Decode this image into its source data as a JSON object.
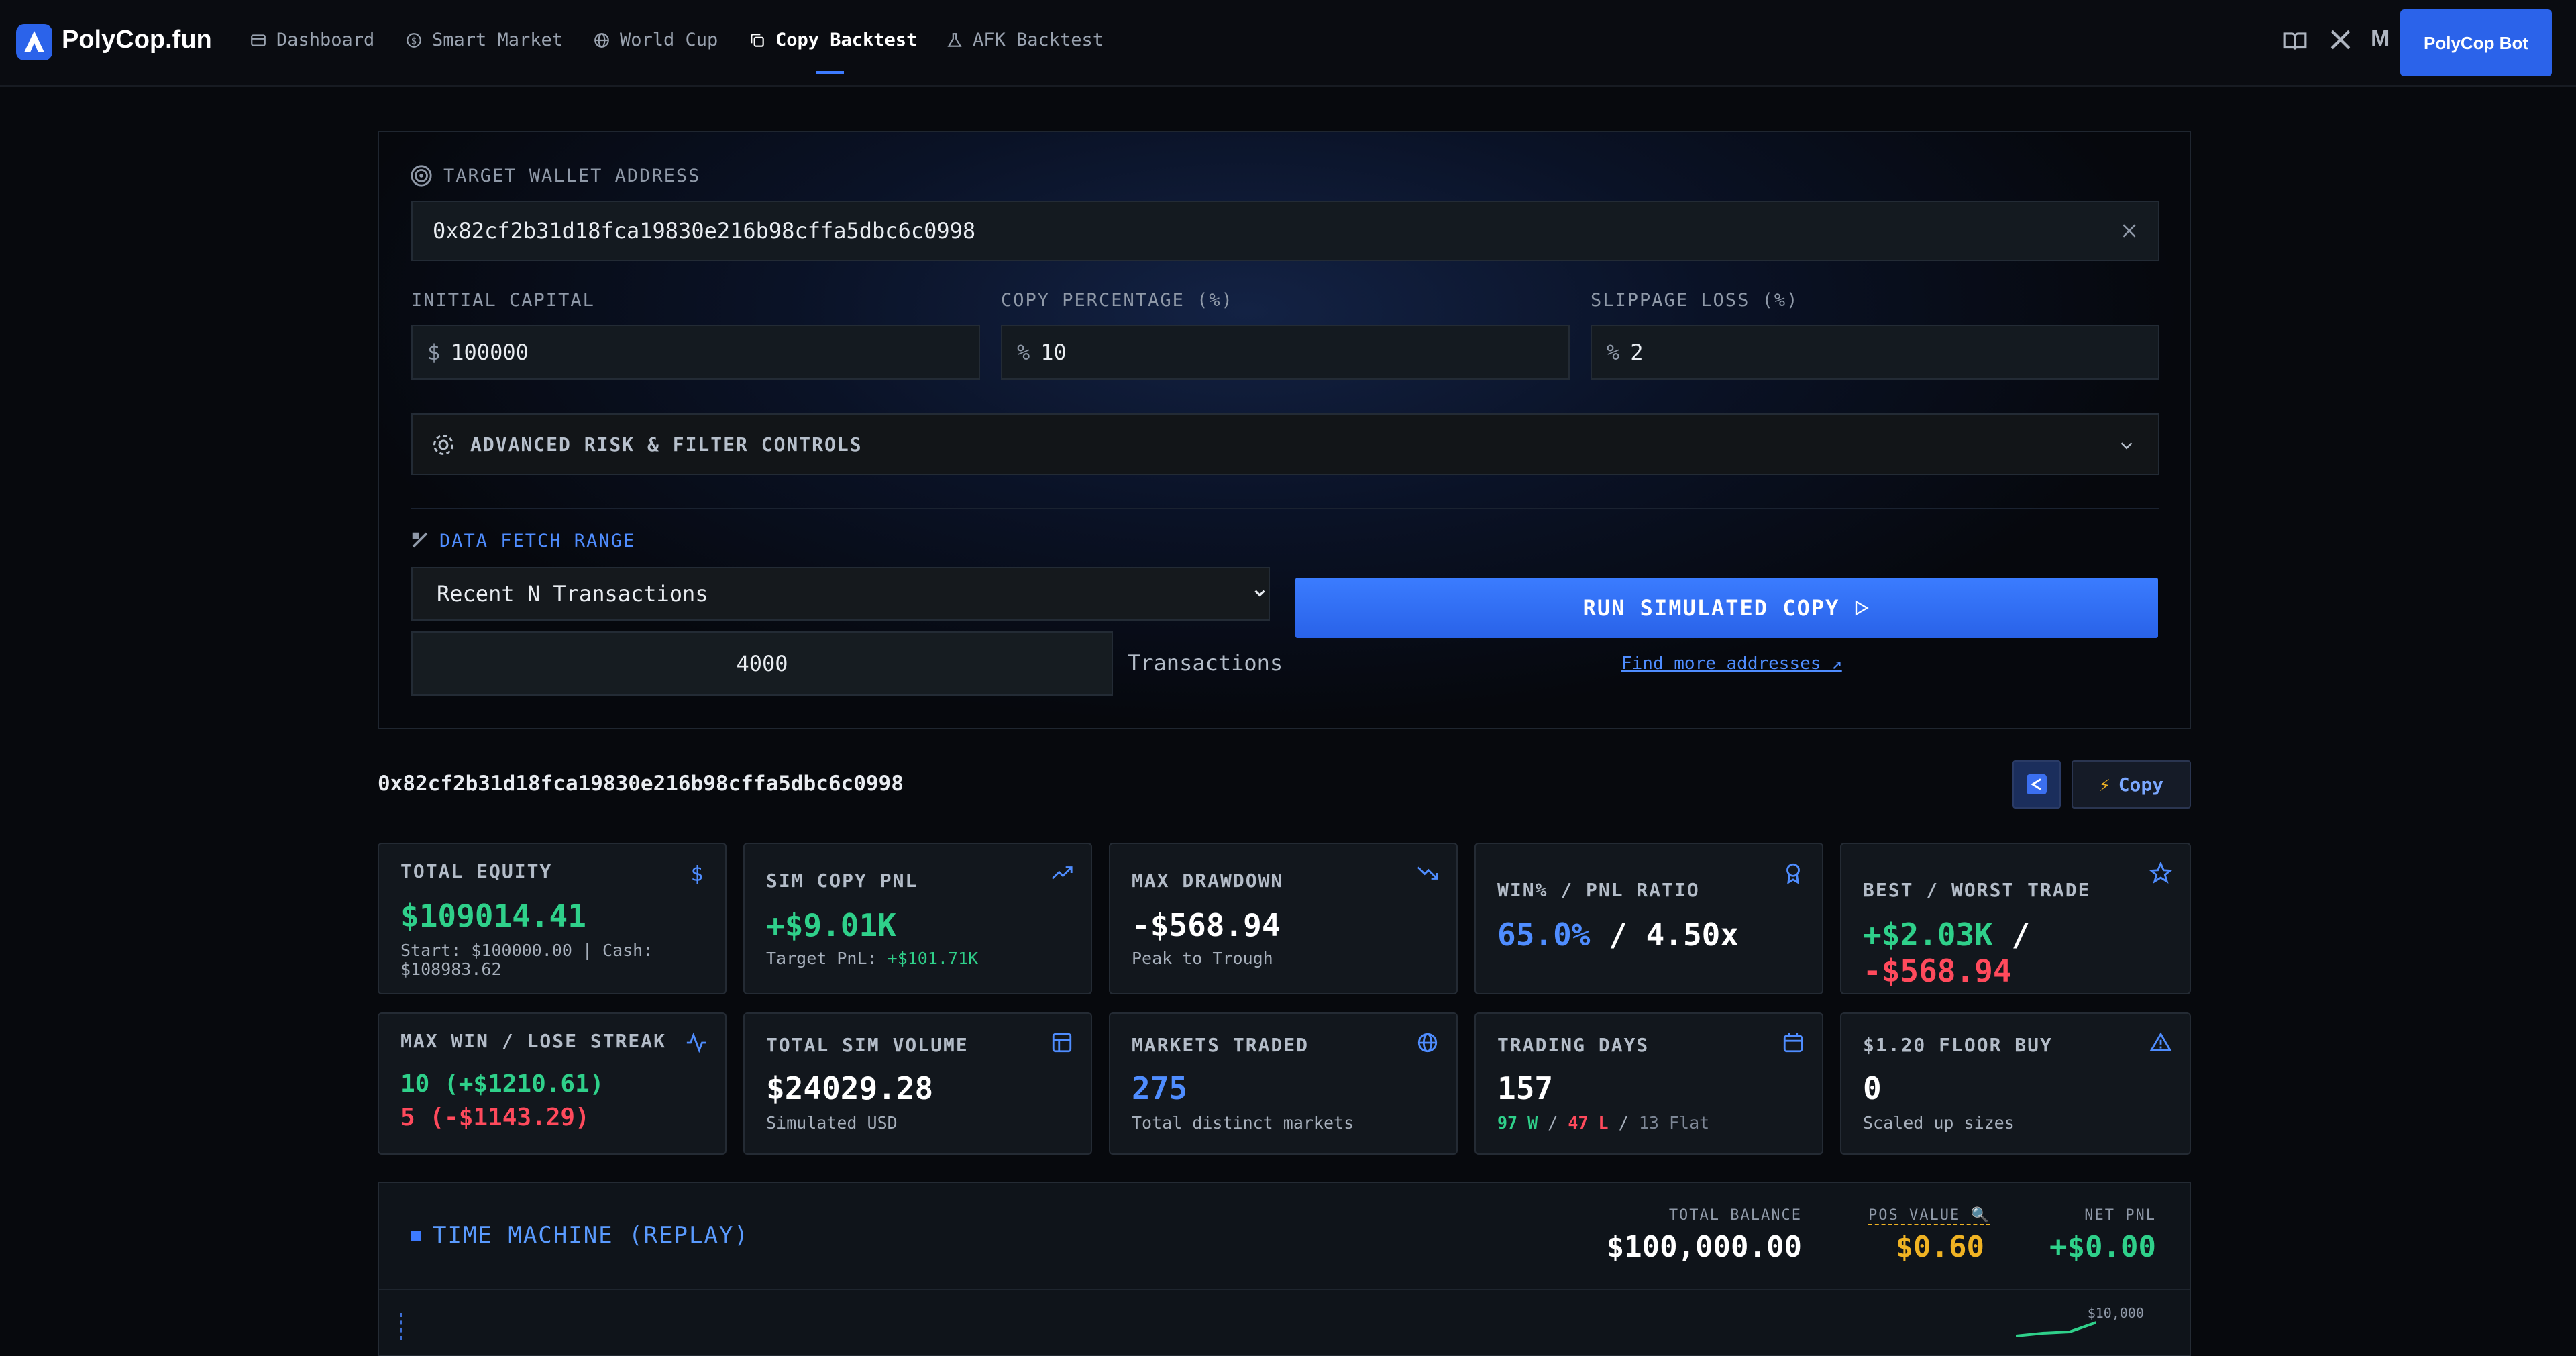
{
  "app": {
    "brand": "PolyCop.fun",
    "bot_button": "PolyCop Bot"
  },
  "nav": [
    {
      "label": "Dashboard",
      "icon": "dashboard-icon"
    },
    {
      "label": "Smart Market",
      "icon": "dollar-circle-icon"
    },
    {
      "label": "World Cup",
      "icon": "globe-icon"
    },
    {
      "label": "Copy Backtest",
      "icon": "copy-icon",
      "active": true
    },
    {
      "label": "AFK Backtest",
      "icon": "flask-icon"
    }
  ],
  "form": {
    "wallet_label": "TARGET WALLET ADDRESS",
    "wallet_value": "0x82cf2b31d18fca19830e216b98cffa5dbc6c0998",
    "capital_label": "INITIAL CAPITAL",
    "capital_prefix": "$",
    "capital_value": "100000",
    "copy_label": "COPY PERCENTAGE (%)",
    "copy_prefix": "%",
    "copy_value": "10",
    "slippage_label": "SLIPPAGE LOSS (%)",
    "slippage_prefix": "%",
    "slippage_value": "2",
    "advanced_label": "ADVANCED RISK & FILTER CONTROLS",
    "fetch_label": "DATA FETCH RANGE",
    "fetch_mode": "Recent N Transactions",
    "tx_count": "4000",
    "tx_unit": "Transactions",
    "run_label": "RUN SIMULATED COPY",
    "find_more": "Find more addresses ↗"
  },
  "result": {
    "address": "0x82cf2b31d18fca19830e216b98cffa5dbc6c0998",
    "copy_button": "Copy"
  },
  "cards": {
    "total_equity": {
      "title": "TOTAL EQUITY",
      "value": "$109014.41",
      "sub": "Start: $100000.00 | Cash:",
      "sub2": "$108983.62"
    },
    "sim_pnl": {
      "title": "SIM COPY PNL",
      "value": "+$9.01K",
      "sub_label": "Target PnL:",
      "sub_value": "+$101.71K"
    },
    "drawdown": {
      "title": "MAX DRAWDOWN",
      "value": "-$568.94",
      "sub": "Peak to Trough"
    },
    "winpnl": {
      "title": "WIN% / PNL RATIO",
      "win": "65.0%",
      "sep": "/",
      "ratio": "4.50x"
    },
    "bestworst": {
      "title": "BEST / WORST TRADE",
      "best": "+$2.03K",
      "sep": "/",
      "worst": "-$568.94"
    },
    "streak": {
      "title": "MAX WIN / LOSE STREAK",
      "win": "10 (+$1210.61)",
      "lose": "5 (-$1143.29)"
    },
    "volume": {
      "title": "TOTAL SIM VOLUME",
      "value": "$24029.28",
      "sub": "Simulated USD"
    },
    "markets": {
      "title": "MARKETS TRADED",
      "value": "275",
      "sub": "Total distinct markets"
    },
    "days": {
      "title": "TRADING DAYS",
      "value": "157",
      "w": "97 W",
      "l": "47 L",
      "flat": "13 Flat",
      "sep": "/"
    },
    "floor": {
      "title": "$1.20 FLOOR BUY",
      "value": "0",
      "sub": "Scaled up sizes"
    }
  },
  "time_machine": {
    "title": "TIME MACHINE (REPLAY)",
    "balance_label": "TOTAL BALANCE",
    "balance": "$100,000.00",
    "pos_label": "POS VALUE",
    "pos_value": "$0.60",
    "pnl_label": "NET PNL",
    "pnl_value": "+$0.00",
    "axis_label": "$10,000"
  }
}
